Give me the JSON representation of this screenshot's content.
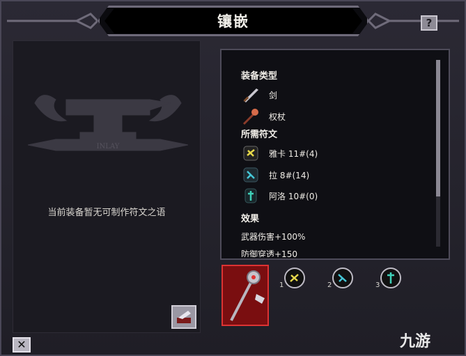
{
  "window": {
    "title": "镶嵌",
    "help_label": "?",
    "close_label": "✕"
  },
  "left_panel": {
    "anvil_label": "INLAY",
    "empty_message": "当前装备暂无可制作符文之语"
  },
  "info": {
    "equipment_type_heading": "装备类型",
    "equipment_types": [
      {
        "icon": "sword-icon",
        "label": "剑"
      },
      {
        "icon": "scepter-icon",
        "label": "权杖"
      }
    ],
    "required_runes_heading": "所需符文",
    "runes": [
      {
        "icon": "rune-yellow-icon",
        "label": "雅卡 11#(4)",
        "color": "#e6d84a"
      },
      {
        "icon": "rune-cyan-icon",
        "label": "拉 8#(14)",
        "color": "#45c6d6"
      },
      {
        "icon": "rune-teal-icon",
        "label": "阿洛 10#(0)",
        "color": "#3fd1b8"
      }
    ],
    "effects_heading": "效果",
    "effects": [
      "武器伤害+100%",
      "防御穿透+150"
    ]
  },
  "slots": {
    "rune_numbers": [
      "1",
      "2",
      "3"
    ]
  },
  "watermark": "九游",
  "colors": {
    "slot_red": "#7a0e10",
    "accent": "#d33"
  }
}
